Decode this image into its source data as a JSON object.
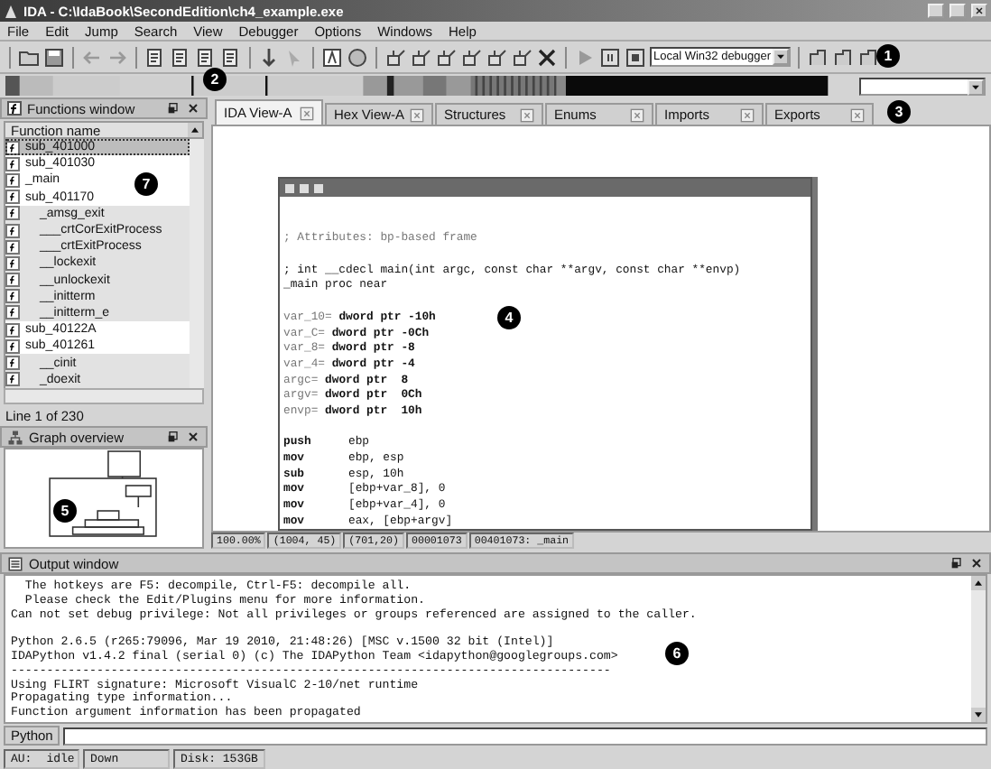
{
  "window": {
    "title": "IDA - C:\\IdaBook\\SecondEdition\\ch4_example.exe"
  },
  "menu": [
    "File",
    "Edit",
    "Jump",
    "Search",
    "View",
    "Debugger",
    "Options",
    "Windows",
    "Help"
  ],
  "toolbar": {
    "debugger": "Local Win32 debugger"
  },
  "functions_window": {
    "title": "Functions window",
    "column": "Function name",
    "line_info": "Line 1 of 230",
    "rows": [
      {
        "name": "sub_401000",
        "kind": "user",
        "selected": true
      },
      {
        "name": "sub_401030",
        "kind": "user",
        "selected": false
      },
      {
        "name": "_main",
        "kind": "user",
        "selected": false
      },
      {
        "name": "sub_401170",
        "kind": "user",
        "selected": false
      },
      {
        "name": "_amsg_exit",
        "kind": "library",
        "selected": false
      },
      {
        "name": "___crtCorExitProcess",
        "kind": "library",
        "selected": false
      },
      {
        "name": "___crtExitProcess",
        "kind": "library",
        "selected": false
      },
      {
        "name": "__lockexit",
        "kind": "library",
        "selected": false
      },
      {
        "name": "__unlockexit",
        "kind": "library",
        "selected": false
      },
      {
        "name": "__initterm",
        "kind": "library",
        "selected": false
      },
      {
        "name": "__initterm_e",
        "kind": "library",
        "selected": false
      },
      {
        "name": "sub_40122A",
        "kind": "user",
        "selected": false
      },
      {
        "name": "sub_401261",
        "kind": "user",
        "selected": false
      },
      {
        "name": "__cinit",
        "kind": "library",
        "selected": false
      },
      {
        "name": "_doexit",
        "kind": "library",
        "selected": false
      }
    ]
  },
  "graph_overview": {
    "title": "Graph overview"
  },
  "tabs": [
    {
      "label": "IDA View-A",
      "selected": true
    },
    {
      "label": "Hex View-A",
      "selected": false
    },
    {
      "label": "Structures",
      "selected": false
    },
    {
      "label": "Enums",
      "selected": false
    },
    {
      "label": "Imports",
      "selected": false
    },
    {
      "label": "Exports",
      "selected": false
    }
  ],
  "graph_node": {
    "lines": [
      {
        "kind": "gap"
      },
      {
        "kind": "gap"
      },
      {
        "kind": "comment",
        "text": "; Attributes: bp-based frame"
      },
      {
        "kind": "gap"
      },
      {
        "kind": "code",
        "text": "; int __cdecl main(int argc, const char **argv, const char **envp)"
      },
      {
        "kind": "code",
        "text": "_main proc near"
      },
      {
        "kind": "gap"
      },
      {
        "kind": "var",
        "name": "var_10=",
        "text": " dword ptr -10h"
      },
      {
        "kind": "var",
        "name": "var_C=",
        "text": " dword ptr -0Ch"
      },
      {
        "kind": "var",
        "name": "var_8=",
        "text": " dword ptr -8"
      },
      {
        "kind": "var",
        "name": "var_4=",
        "text": " dword ptr -4"
      },
      {
        "kind": "var",
        "name": "argc=",
        "text": " dword ptr  8"
      },
      {
        "kind": "var",
        "name": "argv=",
        "text": " dword ptr  0Ch"
      },
      {
        "kind": "var",
        "name": "envp=",
        "text": " dword ptr  10h"
      },
      {
        "kind": "gap"
      },
      {
        "kind": "insn",
        "name": "push",
        "text": "ebp"
      },
      {
        "kind": "insn",
        "name": "mov",
        "text": "ebp, esp"
      },
      {
        "kind": "insn",
        "name": "sub",
        "text": "esp, 10h"
      },
      {
        "kind": "insn",
        "name": "mov",
        "text": "[ebp+var_8], 0"
      },
      {
        "kind": "insn",
        "name": "mov",
        "text": "[ebp+var_4], 0"
      },
      {
        "kind": "insn",
        "name": "mov",
        "text": "eax, [ebp+argv]"
      }
    ]
  },
  "view_status": [
    "100.00%",
    "(1004, 45)",
    "(701,20)",
    "00001073",
    "00401073: _main"
  ],
  "output_window": {
    "title": "Output window",
    "lines": [
      "  The hotkeys are F5: decompile, Ctrl-F5: decompile all.",
      "  Please check the Edit/Plugins menu for more information.",
      "Can not set debug privilege: Not all privileges or groups referenced are assigned to the caller.",
      {
        "kind": "gap"
      },
      "Python 2.6.5 (r265:79096, Mar 19 2010, 21:48:26) [MSC v.1500 32 bit (Intel)]",
      "IDAPython v1.4.2 final (serial 0) (c) The IDAPython Team <idapython@googlegroups.com>",
      "------------------------------------------------------------------------------------",
      "Using FLIRT signature: Microsoft VisualC 2-10/net runtime",
      "Propagating type information...",
      "Function argument information has been propagated"
    ]
  },
  "python": {
    "label": "Python"
  },
  "status_bar": {
    "au": "AU:",
    "state": "idle",
    "direction": "Down",
    "disk": "Disk: 153GB"
  },
  "callouts": [
    "1",
    "2",
    "3",
    "4",
    "5",
    "6",
    "7"
  ]
}
